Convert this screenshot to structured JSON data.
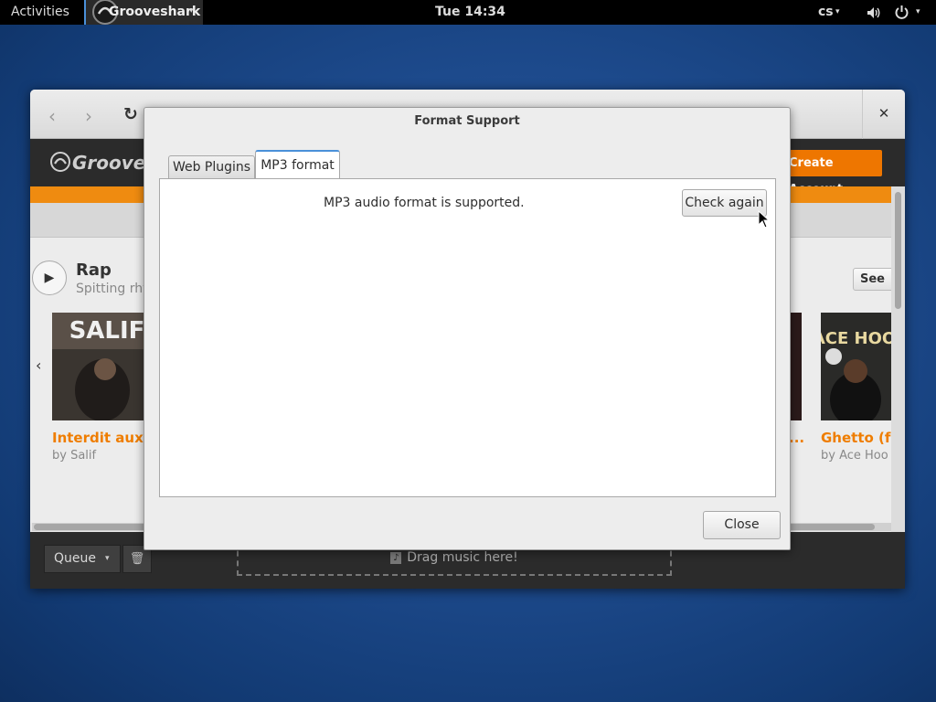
{
  "top_bar": {
    "activities_label": "Activities",
    "app_name": "Grooveshark",
    "clock": "Tue 14:34",
    "keyboard_layout": "cs",
    "volume_icon": "volume-icon",
    "power_icon": "power-icon"
  },
  "browser": {
    "back_icon": "‹",
    "forward_icon": "›",
    "reload_icon": "↻",
    "close_icon": "✕"
  },
  "grooveshark": {
    "logo_text": "Groovesh",
    "create_account_label": "Create Account",
    "section_title": "Rap",
    "section_subtitle": "Spitting rhy",
    "see_all_label": "See A",
    "play_icon": "▶",
    "carousel_left_icon": "‹",
    "albums": [
      {
        "title": "Interdit aux ...",
        "artist": "by Salif",
        "cover_text": "SALIF"
      },
      {
        "title": "Ghetto (f",
        "artist": "by Ace Hoo",
        "cover_text": "ACE HOOD"
      }
    ],
    "partial_album_title": "...",
    "queue_label": "Queue",
    "trash_icon": "🗑",
    "drop_zone_label": "Drag music here!",
    "music_note_icon": "♪"
  },
  "dialog": {
    "title": "Format Support",
    "tabs": [
      {
        "label": "Web Plugins",
        "active": false
      },
      {
        "label": "MP3 format",
        "active": true
      }
    ],
    "status_message": "MP3 audio format is supported.",
    "check_again_label": "Check again",
    "close_label": "Close"
  },
  "colors": {
    "accent": "#4a90d9",
    "brand_orange": "#ee7600",
    "desktop_blue": "#1d4a8c"
  }
}
